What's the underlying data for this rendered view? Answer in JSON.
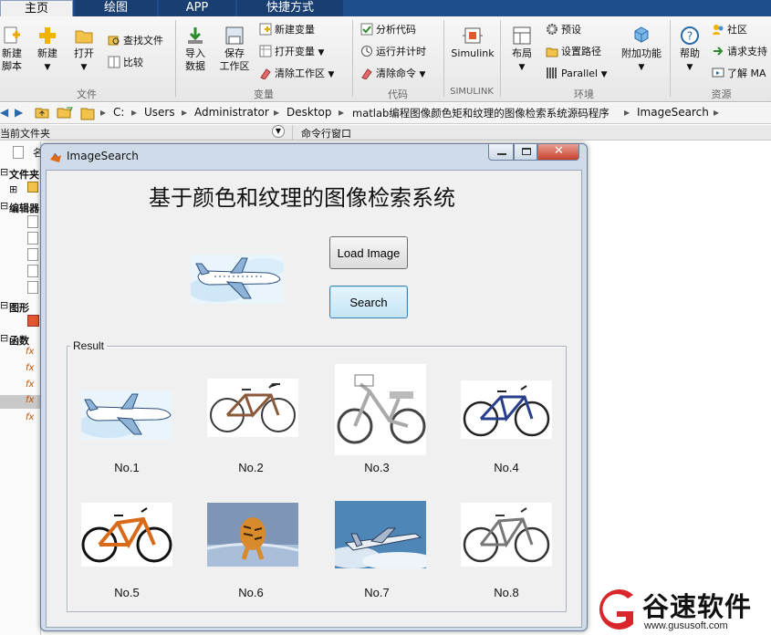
{
  "ribbon": {
    "tabs": [
      "主页",
      "绘图",
      "APP",
      "快捷方式"
    ],
    "big_buttons": [
      {
        "label1": "新建",
        "label2": "脚本"
      },
      {
        "label1": "新建",
        "label2": ""
      },
      {
        "label1": "打开",
        "label2": ""
      },
      {
        "label1": "导入",
        "label2": "数据"
      },
      {
        "label1": "保存",
        "label2": "工作区"
      },
      {
        "label1": "Simulink",
        "label2": ""
      },
      {
        "label1": "布局",
        "label2": ""
      },
      {
        "label1": "附加功能",
        "label2": ""
      },
      {
        "label1": "帮助",
        "label2": ""
      }
    ],
    "small_buttons": [
      "查找文件",
      "比较",
      "新建变量",
      "打开变量",
      "清除工作区",
      "分析代码",
      "运行并计时",
      "清除命令",
      "预设",
      "设置路径",
      "Parallel",
      "社区",
      "请求支持",
      "了解 MA"
    ],
    "groups": [
      "文件",
      "变量",
      "代码",
      "SIMULINK",
      "环境",
      "资源"
    ]
  },
  "address_bar": {
    "path": [
      "C:",
      "Users",
      "Administrator",
      "Desktop",
      "matlab编程图像颜色矩和纹理的图像检索系统源码程序",
      "ImageSearch"
    ]
  },
  "panels": {
    "current_folder": "当前文件夹",
    "command_window": "命令行窗口",
    "left_sections": [
      "文件夹",
      "编辑器",
      "图形",
      "函数"
    ]
  },
  "figure": {
    "window_title": "ImageSearch",
    "heading": "基于颜色和纹理的图像检索系统",
    "load_button": "Load Image",
    "search_button": "Search",
    "result_label": "Result",
    "results": [
      "No.1",
      "No.2",
      "No.3",
      "No.4",
      "No.5",
      "No.6",
      "No.7",
      "No.8"
    ]
  },
  "watermark": {
    "name": "谷速软件",
    "url": "www.gususoft.com"
  },
  "colors": {
    "tabbar": "#1f4e8c",
    "figure_frame": "#cfdbe9",
    "logo_red": "#d8262a"
  }
}
